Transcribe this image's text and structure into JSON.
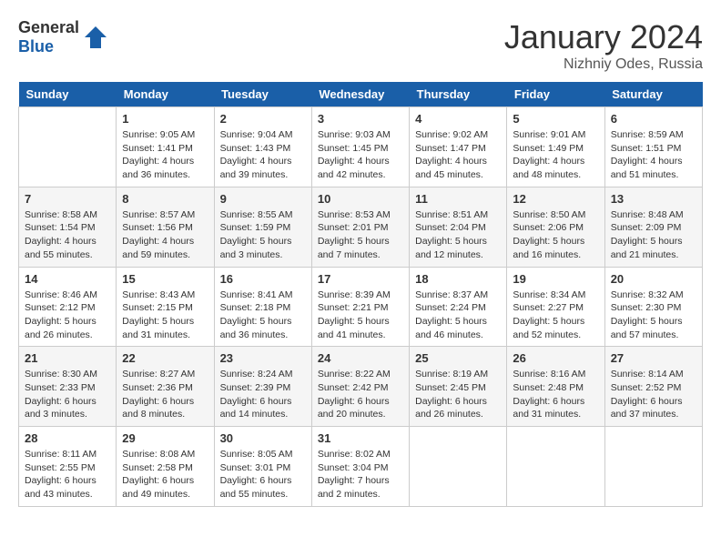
{
  "header": {
    "logo_general": "General",
    "logo_blue": "Blue",
    "title": "January 2024",
    "subtitle": "Nizhniy Odes, Russia"
  },
  "weekdays": [
    "Sunday",
    "Monday",
    "Tuesday",
    "Wednesday",
    "Thursday",
    "Friday",
    "Saturday"
  ],
  "weeks": [
    [
      {
        "day": "",
        "sunrise": "",
        "sunset": "",
        "daylight": ""
      },
      {
        "day": "1",
        "sunrise": "Sunrise: 9:05 AM",
        "sunset": "Sunset: 1:41 PM",
        "daylight": "Daylight: 4 hours and 36 minutes."
      },
      {
        "day": "2",
        "sunrise": "Sunrise: 9:04 AM",
        "sunset": "Sunset: 1:43 PM",
        "daylight": "Daylight: 4 hours and 39 minutes."
      },
      {
        "day": "3",
        "sunrise": "Sunrise: 9:03 AM",
        "sunset": "Sunset: 1:45 PM",
        "daylight": "Daylight: 4 hours and 42 minutes."
      },
      {
        "day": "4",
        "sunrise": "Sunrise: 9:02 AM",
        "sunset": "Sunset: 1:47 PM",
        "daylight": "Daylight: 4 hours and 45 minutes."
      },
      {
        "day": "5",
        "sunrise": "Sunrise: 9:01 AM",
        "sunset": "Sunset: 1:49 PM",
        "daylight": "Daylight: 4 hours and 48 minutes."
      },
      {
        "day": "6",
        "sunrise": "Sunrise: 8:59 AM",
        "sunset": "Sunset: 1:51 PM",
        "daylight": "Daylight: 4 hours and 51 minutes."
      }
    ],
    [
      {
        "day": "7",
        "sunrise": "Sunrise: 8:58 AM",
        "sunset": "Sunset: 1:54 PM",
        "daylight": "Daylight: 4 hours and 55 minutes."
      },
      {
        "day": "8",
        "sunrise": "Sunrise: 8:57 AM",
        "sunset": "Sunset: 1:56 PM",
        "daylight": "Daylight: 4 hours and 59 minutes."
      },
      {
        "day": "9",
        "sunrise": "Sunrise: 8:55 AM",
        "sunset": "Sunset: 1:59 PM",
        "daylight": "Daylight: 5 hours and 3 minutes."
      },
      {
        "day": "10",
        "sunrise": "Sunrise: 8:53 AM",
        "sunset": "Sunset: 2:01 PM",
        "daylight": "Daylight: 5 hours and 7 minutes."
      },
      {
        "day": "11",
        "sunrise": "Sunrise: 8:51 AM",
        "sunset": "Sunset: 2:04 PM",
        "daylight": "Daylight: 5 hours and 12 minutes."
      },
      {
        "day": "12",
        "sunrise": "Sunrise: 8:50 AM",
        "sunset": "Sunset: 2:06 PM",
        "daylight": "Daylight: 5 hours and 16 minutes."
      },
      {
        "day": "13",
        "sunrise": "Sunrise: 8:48 AM",
        "sunset": "Sunset: 2:09 PM",
        "daylight": "Daylight: 5 hours and 21 minutes."
      }
    ],
    [
      {
        "day": "14",
        "sunrise": "Sunrise: 8:46 AM",
        "sunset": "Sunset: 2:12 PM",
        "daylight": "Daylight: 5 hours and 26 minutes."
      },
      {
        "day": "15",
        "sunrise": "Sunrise: 8:43 AM",
        "sunset": "Sunset: 2:15 PM",
        "daylight": "Daylight: 5 hours and 31 minutes."
      },
      {
        "day": "16",
        "sunrise": "Sunrise: 8:41 AM",
        "sunset": "Sunset: 2:18 PM",
        "daylight": "Daylight: 5 hours and 36 minutes."
      },
      {
        "day": "17",
        "sunrise": "Sunrise: 8:39 AM",
        "sunset": "Sunset: 2:21 PM",
        "daylight": "Daylight: 5 hours and 41 minutes."
      },
      {
        "day": "18",
        "sunrise": "Sunrise: 8:37 AM",
        "sunset": "Sunset: 2:24 PM",
        "daylight": "Daylight: 5 hours and 46 minutes."
      },
      {
        "day": "19",
        "sunrise": "Sunrise: 8:34 AM",
        "sunset": "Sunset: 2:27 PM",
        "daylight": "Daylight: 5 hours and 52 minutes."
      },
      {
        "day": "20",
        "sunrise": "Sunrise: 8:32 AM",
        "sunset": "Sunset: 2:30 PM",
        "daylight": "Daylight: 5 hours and 57 minutes."
      }
    ],
    [
      {
        "day": "21",
        "sunrise": "Sunrise: 8:30 AM",
        "sunset": "Sunset: 2:33 PM",
        "daylight": "Daylight: 6 hours and 3 minutes."
      },
      {
        "day": "22",
        "sunrise": "Sunrise: 8:27 AM",
        "sunset": "Sunset: 2:36 PM",
        "daylight": "Daylight: 6 hours and 8 minutes."
      },
      {
        "day": "23",
        "sunrise": "Sunrise: 8:24 AM",
        "sunset": "Sunset: 2:39 PM",
        "daylight": "Daylight: 6 hours and 14 minutes."
      },
      {
        "day": "24",
        "sunrise": "Sunrise: 8:22 AM",
        "sunset": "Sunset: 2:42 PM",
        "daylight": "Daylight: 6 hours and 20 minutes."
      },
      {
        "day": "25",
        "sunrise": "Sunrise: 8:19 AM",
        "sunset": "Sunset: 2:45 PM",
        "daylight": "Daylight: 6 hours and 26 minutes."
      },
      {
        "day": "26",
        "sunrise": "Sunrise: 8:16 AM",
        "sunset": "Sunset: 2:48 PM",
        "daylight": "Daylight: 6 hours and 31 minutes."
      },
      {
        "day": "27",
        "sunrise": "Sunrise: 8:14 AM",
        "sunset": "Sunset: 2:52 PM",
        "daylight": "Daylight: 6 hours and 37 minutes."
      }
    ],
    [
      {
        "day": "28",
        "sunrise": "Sunrise: 8:11 AM",
        "sunset": "Sunset: 2:55 PM",
        "daylight": "Daylight: 6 hours and 43 minutes."
      },
      {
        "day": "29",
        "sunrise": "Sunrise: 8:08 AM",
        "sunset": "Sunset: 2:58 PM",
        "daylight": "Daylight: 6 hours and 49 minutes."
      },
      {
        "day": "30",
        "sunrise": "Sunrise: 8:05 AM",
        "sunset": "Sunset: 3:01 PM",
        "daylight": "Daylight: 6 hours and 55 minutes."
      },
      {
        "day": "31",
        "sunrise": "Sunrise: 8:02 AM",
        "sunset": "Sunset: 3:04 PM",
        "daylight": "Daylight: 7 hours and 2 minutes."
      },
      {
        "day": "",
        "sunrise": "",
        "sunset": "",
        "daylight": ""
      },
      {
        "day": "",
        "sunrise": "",
        "sunset": "",
        "daylight": ""
      },
      {
        "day": "",
        "sunrise": "",
        "sunset": "",
        "daylight": ""
      }
    ]
  ]
}
